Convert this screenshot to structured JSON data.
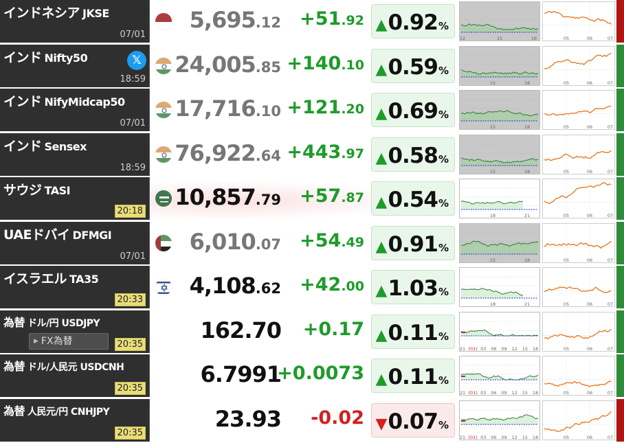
{
  "rows": [
    {
      "name": "インドネシア",
      "sub": "JKSE",
      "time": "07/01",
      "time_highlight": false,
      "flag": "indonesia-flag-icon",
      "price_int": "5,695",
      "price_dec": ".12",
      "price_dark": false,
      "chg_int": "+51",
      "chg_dec": ".92",
      "dir": "up",
      "pct": "0.92",
      "chart1_gray": true,
      "chart1_xlabels": [
        "12",
        "15",
        "18"
      ],
      "status_color": "#b01515"
    },
    {
      "name": "インド",
      "sub": "Nifty50",
      "time": "18:59",
      "time_highlight": false,
      "flag": "india-flag-icon",
      "x_button": "𝕏",
      "price_int": "24,005",
      "price_dec": ".85",
      "price_dark": false,
      "chg_int": "+140",
      "chg_dec": ".10",
      "dir": "up",
      "pct": "0.59",
      "chart1_gray": true,
      "chart1_xlabels": [
        "15",
        "18"
      ],
      "status_color": "#2e8b3a"
    },
    {
      "name": "インド",
      "sub": "NifyMidcap50",
      "time": "07/01",
      "time_highlight": false,
      "flag": "india-flag-icon",
      "price_int": "17,716",
      "price_dec": ".10",
      "price_dark": false,
      "chg_int": "+121",
      "chg_dec": ".20",
      "dir": "up",
      "pct": "0.69",
      "chart1_gray": true,
      "chart1_xlabels": [
        "15",
        "18"
      ],
      "status_color": "#2e8b3a"
    },
    {
      "name": "インド",
      "sub": "Sensex",
      "time": "18:59",
      "time_highlight": false,
      "flag": "india-flag-icon",
      "price_int": "76,922",
      "price_dec": ".64",
      "price_dark": false,
      "chg_int": "+443",
      "chg_dec": ".97",
      "dir": "up",
      "pct": "0.58",
      "chart1_gray": true,
      "chart1_xlabels": [
        "15",
        "18"
      ],
      "status_color": "#2e8b3a"
    },
    {
      "name": "サウジ",
      "sub": "TASI",
      "time": "20:18",
      "time_highlight": true,
      "flag": "saudi-flag-icon",
      "price_int": "10,857",
      "price_dec": ".79",
      "price_dark": true,
      "chg_int": "+57",
      "chg_dec": ".87",
      "dir": "up",
      "pct": "0.54",
      "chart1_gray": false,
      "chart1_xlabels": [
        "18",
        "21"
      ],
      "status_color": "#2e8b3a"
    },
    {
      "name": "UAEドバイ",
      "sub": "DFMGI",
      "time": "07/01",
      "time_highlight": false,
      "flag": "uae-flag-icon",
      "price_int": "6,010",
      "price_dec": ".07",
      "price_dark": false,
      "chg_int": "+54",
      "chg_dec": ".49",
      "dir": "up",
      "pct": "0.91",
      "chart1_gray": true,
      "chart1_xlabels": [
        "15",
        "18"
      ],
      "status_color": "#2e8b3a"
    },
    {
      "name": "イスラエル",
      "sub": "TA35",
      "time": "20:33",
      "time_highlight": true,
      "flag": "israel-flag-icon",
      "price_int": "4,108",
      "price_dec": ".62",
      "price_dark": true,
      "chg_int": "+42",
      "chg_dec": ".00",
      "dir": "up",
      "pct": "1.03",
      "chart1_gray": false,
      "chart1_xlabels": [
        "18",
        "21"
      ],
      "status_color": "#2e8b3a"
    },
    {
      "name": "為替",
      "sub": "ドル/円 USDJPY",
      "time": "20:35",
      "time_highlight": true,
      "flag": "",
      "fx_button": "FX為替",
      "price_int": "162.70",
      "price_dec": "",
      "price_dark": true,
      "chg_int": "+0.17",
      "chg_dec": "",
      "dir": "up",
      "pct": "0.11",
      "chart1_gray": false,
      "chart1_xlabels": [
        "21",
        "(01)",
        "03",
        "06",
        "09",
        "12",
        "15",
        "18"
      ],
      "status_color": "#2e8b3a"
    },
    {
      "name": "為替",
      "sub": "ドル/人民元 USDCNH",
      "time": "20:35",
      "time_highlight": true,
      "flag": "",
      "price_int": "6.7991",
      "price_dec": "",
      "price_dark": true,
      "chg_int": "+0.0073",
      "chg_dec": "",
      "dir": "up",
      "pct": "0.11",
      "chart1_gray": false,
      "chart1_xlabels": [
        "21",
        "(01)",
        "03",
        "06",
        "09",
        "12",
        "15",
        "18"
      ],
      "status_color": "#2e8b3a"
    },
    {
      "name": "為替",
      "sub": "人民元/円 CNHJPY",
      "time": "20:35",
      "time_highlight": true,
      "flag": "",
      "price_int": "23.93",
      "price_dec": "",
      "price_dark": true,
      "chg_int": "-0.02",
      "chg_dec": "",
      "dir": "down",
      "pct": "0.07",
      "chart1_gray": false,
      "chart1_xlabels": [
        "21",
        "(01)",
        "03",
        "06",
        "09",
        "12",
        "15",
        "18"
      ],
      "status_color": "#b01515"
    }
  ],
  "chart2_xlabels": [
    "05",
    "06",
    "07"
  ],
  "arrow_up": "▲",
  "arrow_down": "▼",
  "pct_unit": "%",
  "colors": {
    "up": "#1e9b2b",
    "down": "#d32020",
    "line_chart_green": "#2f7a34",
    "line_chart_orange": "#e8741b"
  }
}
